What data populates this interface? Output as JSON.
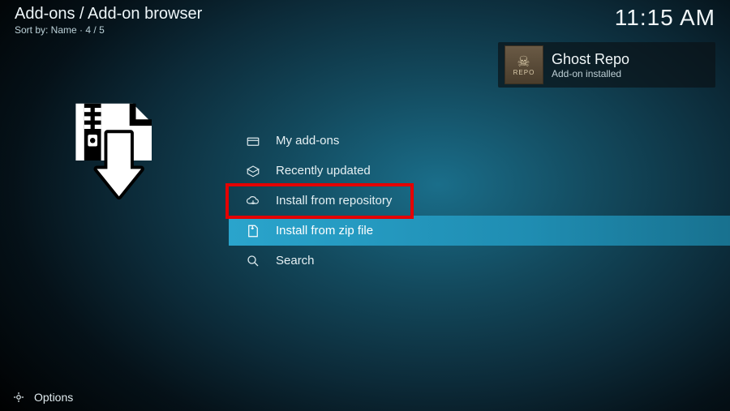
{
  "header": {
    "title": "Add-ons / Add-on browser",
    "sort_label": "Sort by: Name",
    "position": "4 / 5",
    "clock": "11:15 AM"
  },
  "notification": {
    "thumb_top": "☠",
    "thumb_text": "REPO",
    "title": "Ghost Repo",
    "subtitle": "Add-on installed"
  },
  "menu": {
    "items": [
      {
        "icon": "box-icon",
        "label": "My add-ons",
        "selected": false,
        "highlighted": false
      },
      {
        "icon": "openbox-icon",
        "label": "Recently updated",
        "selected": false,
        "highlighted": false
      },
      {
        "icon": "cloud-down-icon",
        "label": "Install from repository",
        "selected": false,
        "highlighted": true
      },
      {
        "icon": "zip-icon",
        "label": "Install from zip file",
        "selected": true,
        "highlighted": false
      },
      {
        "icon": "search-icon",
        "label": "Search",
        "selected": false,
        "highlighted": false
      }
    ]
  },
  "footer": {
    "options_label": "Options"
  }
}
